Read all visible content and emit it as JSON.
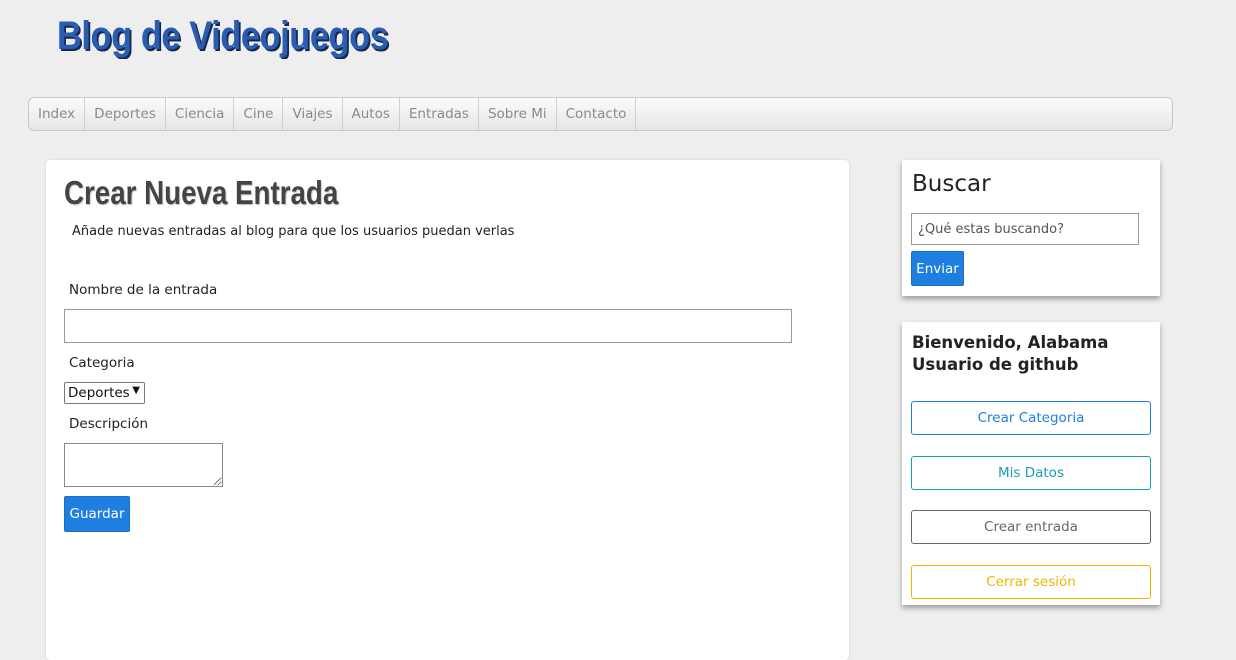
{
  "header": {
    "title": "Blog de Videojuegos"
  },
  "nav": {
    "items": [
      "Index",
      "Deportes",
      "Ciencia",
      "Cine",
      "Viajes",
      "Autos",
      "Entradas",
      "Sobre Mi",
      "Contacto"
    ]
  },
  "main": {
    "title": "Crear Nueva Entrada",
    "subtitle": "Añade nuevas entradas al blog para que los usuarios puedan verlas",
    "form": {
      "name_label": "Nombre de la entrada",
      "name_value": "",
      "category_label": "Categoria",
      "category_selected": "Deportes",
      "description_label": "Descripción",
      "description_value": "",
      "save_label": "Guardar"
    }
  },
  "sidebar": {
    "search": {
      "title": "Buscar",
      "placeholder": "¿Qué estas buscando?",
      "button_label": "Enviar"
    },
    "user": {
      "welcome": "Bienvenido, Alabama Usuario de github",
      "buttons": [
        {
          "label": "Crear Categoria",
          "color": "#1e7fe0"
        },
        {
          "label": "Mis Datos",
          "color": "#1a9bb5"
        },
        {
          "label": "Crear entrada",
          "color": "#666666"
        },
        {
          "label": "Cerrar sesión",
          "color": "#f0b400"
        }
      ]
    }
  },
  "colors": {
    "background": "#eeeeee",
    "primary": "#1e7fe0",
    "title_blue": "#2a5db0"
  }
}
